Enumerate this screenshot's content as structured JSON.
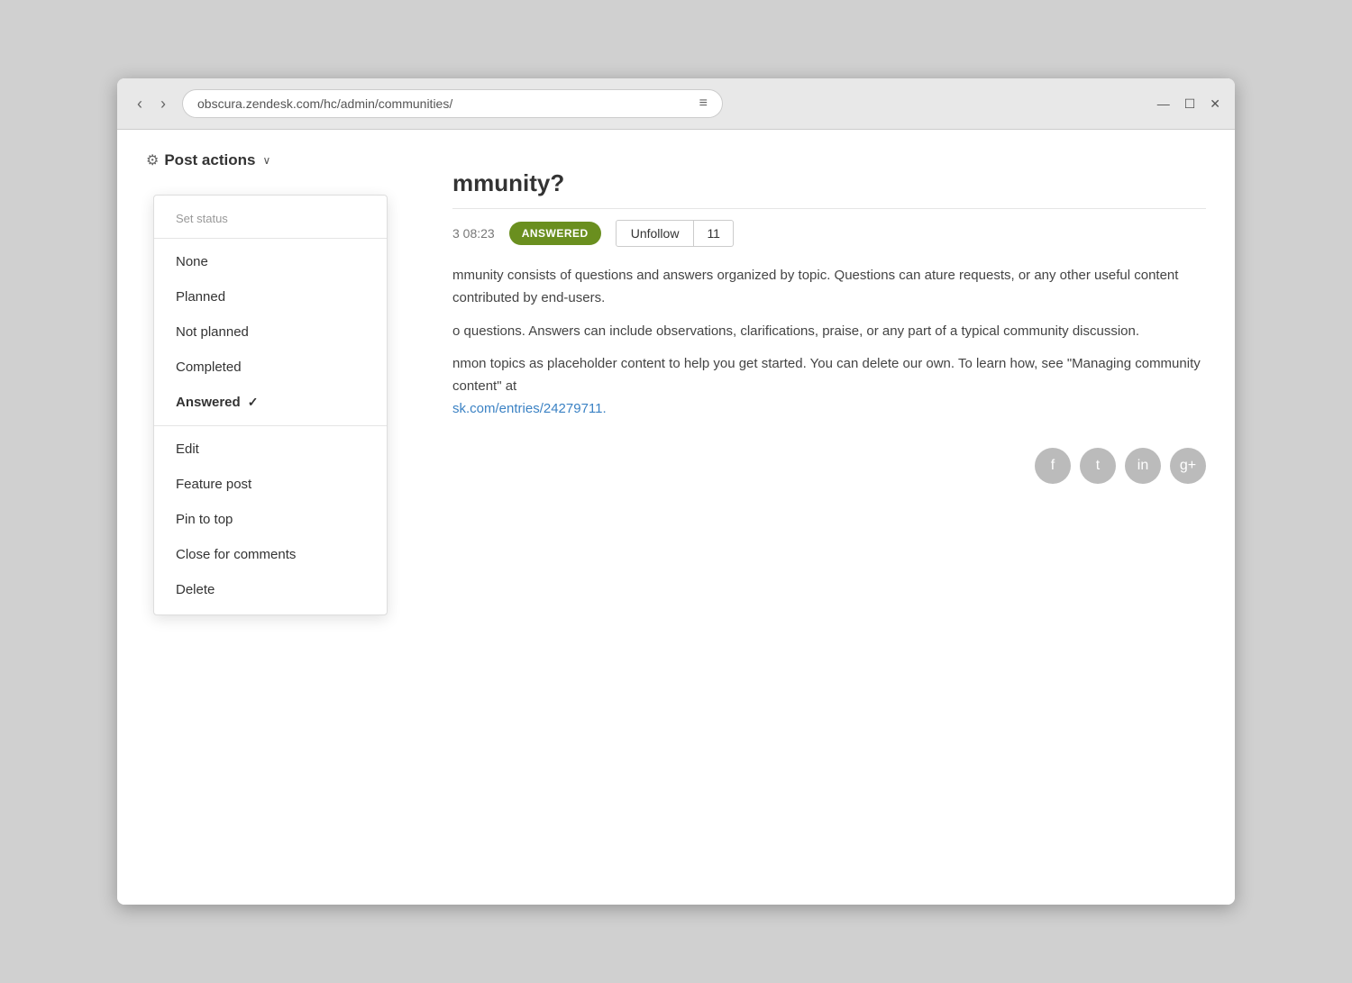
{
  "browser": {
    "url": "obscura.zendesk.com/hc/admin/communities/",
    "back_label": "‹",
    "forward_label": "›",
    "hamburger": "≡",
    "minimize": "—",
    "maximize": "☐",
    "close": "✕"
  },
  "post_actions": {
    "label": "Post actions",
    "chevron": "∨",
    "gear": "⚙"
  },
  "dropdown": {
    "section_label": "Set status",
    "items": [
      {
        "id": "none",
        "label": "None",
        "active": false
      },
      {
        "id": "planned",
        "label": "Planned",
        "active": false
      },
      {
        "id": "not-planned",
        "label": "Not planned",
        "active": false
      },
      {
        "id": "completed",
        "label": "Completed",
        "active": false
      },
      {
        "id": "answered",
        "label": "Answered",
        "active": true
      }
    ],
    "actions": [
      {
        "id": "edit",
        "label": "Edit"
      },
      {
        "id": "feature-post",
        "label": "Feature post"
      },
      {
        "id": "pin-to-top",
        "label": "Pin to top"
      },
      {
        "id": "close-for-comments",
        "label": "Close for comments"
      },
      {
        "id": "delete",
        "label": "Delete"
      }
    ]
  },
  "post": {
    "title": "mmunity?",
    "timestamp": "3 08:23",
    "badge": "ANSWERED",
    "unfollow_label": "Unfollow",
    "follow_count": "11",
    "body_1": "mmunity consists of questions and answers organized by topic. Questions can ature requests, or any other useful content contributed by end-users.",
    "body_2": "o questions. Answers can include observations, clarifications, praise, or any part of a typical community discussion.",
    "body_3": "nmon topics as placeholder content to help you get started. You can delete our own. To learn how, see \"Managing community content\" at",
    "link_text": "sk.com/entries/24279711.",
    "link_href": "#"
  },
  "social": {
    "icons": [
      "f",
      "t",
      "in",
      "g+"
    ]
  }
}
